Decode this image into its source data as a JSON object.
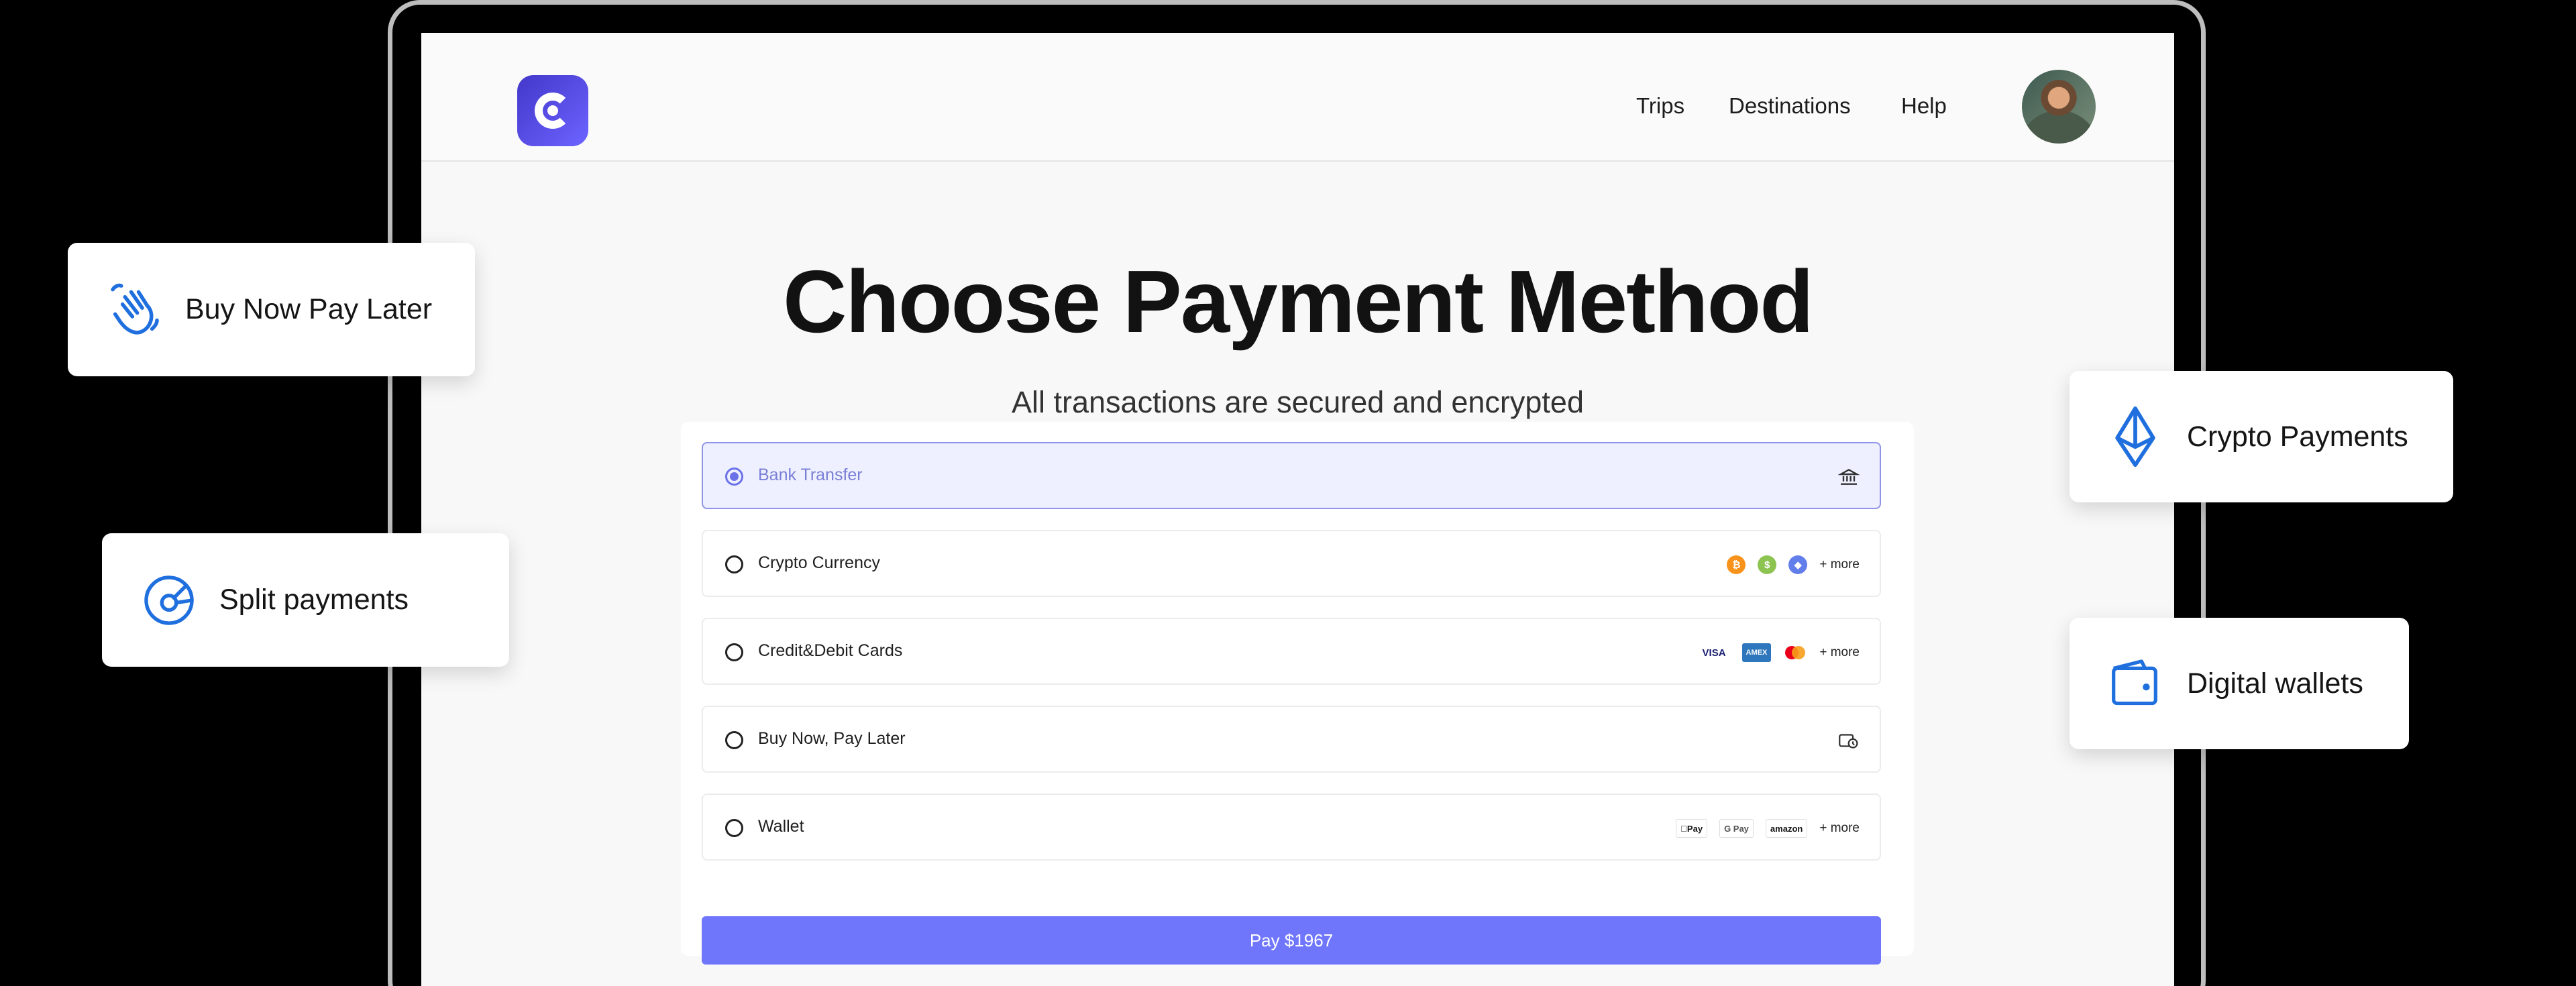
{
  "nav": {
    "trips": "Trips",
    "destinations": "Destinations",
    "help": "Help"
  },
  "main": {
    "title": "Choose Payment Method",
    "subtitle": "All transactions are secured and encrypted"
  },
  "payment_options": [
    {
      "label": "Bank Transfer",
      "selected": true,
      "icon": "bank-icon"
    },
    {
      "label": "Crypto Currency",
      "selected": false,
      "extra": "+ more"
    },
    {
      "label": "Credit&Debit Cards",
      "selected": false,
      "extra": "+ more",
      "cards": [
        "VISA",
        "AMEX"
      ]
    },
    {
      "label": "Buy Now, Pay Later",
      "selected": false,
      "icon": "bnpl-icon"
    },
    {
      "label": "Wallet",
      "selected": false,
      "extra": "+ more",
      "wallets": [
        "Pay",
        "G Pay",
        "amazon"
      ]
    }
  ],
  "pay_button": {
    "label": "Pay $1967"
  },
  "features": {
    "bnpl": "Buy Now Pay Later",
    "split": "Split payments",
    "crypto": "Crypto Payments",
    "wallets": "Digital wallets"
  },
  "colors": {
    "accent": "#7076fb",
    "feature_icon": "#1f6fde",
    "selected_bg": "#eef0ff"
  }
}
